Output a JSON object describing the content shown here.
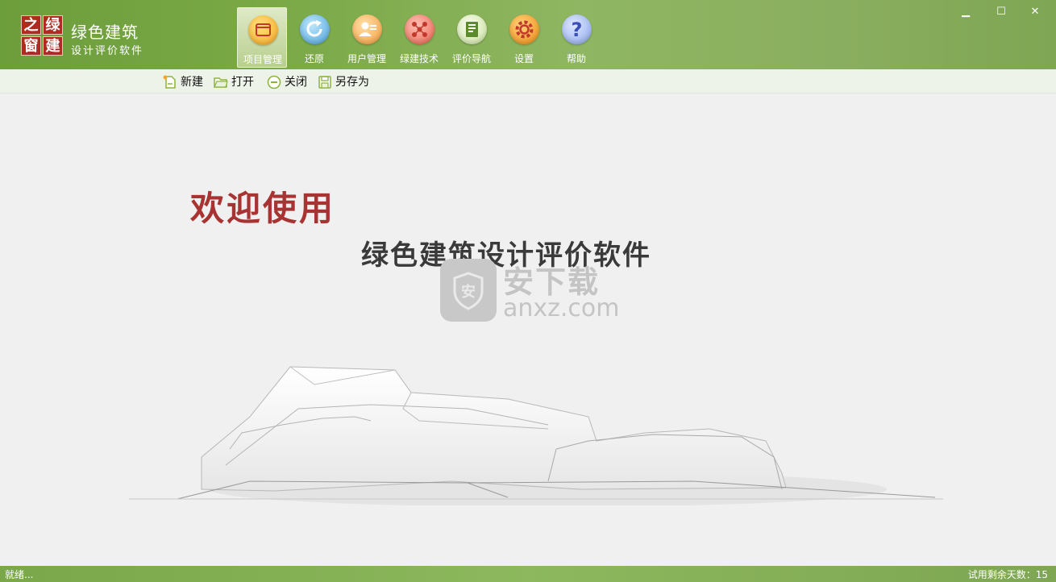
{
  "app": {
    "logo_chars": [
      "之",
      "绿",
      "窗",
      "建"
    ],
    "title": "绿色建筑",
    "subtitle": "设计评价软件"
  },
  "nav": [
    {
      "label": "项目管理",
      "icon": "project-icon",
      "color": "#f7b733",
      "active": true
    },
    {
      "label": "还原",
      "icon": "restore-icon",
      "color": "#5eb3e4",
      "active": false
    },
    {
      "label": "用户管理",
      "icon": "user-icon",
      "color": "#f5a84a",
      "active": false
    },
    {
      "label": "绿建技术",
      "icon": "tech-icon",
      "color": "#ef6f5f",
      "active": false
    },
    {
      "label": "评价导航",
      "icon": "book-icon",
      "color": "#cfe6a8",
      "active": false
    },
    {
      "label": "设置",
      "icon": "gear-icon",
      "color": "#f59a1e",
      "active": false
    },
    {
      "label": "帮助",
      "icon": "help-icon",
      "color": "#8fa9e8",
      "active": false
    }
  ],
  "window": {
    "minimize": "▁",
    "maximize": "☐",
    "close": "✕"
  },
  "toolbar": {
    "new": "新建",
    "open": "打开",
    "close": "关闭",
    "save_as": "另存为"
  },
  "main": {
    "welcome": "欢迎使用",
    "product": "绿色建筑设计评价软件"
  },
  "watermark": {
    "shield_char": "安",
    "cn": "安下载",
    "en": "anxz.com"
  },
  "status": {
    "left": "就绪...",
    "right": "试用剩余天数：15"
  },
  "colors": {
    "brand_green": "#79a845",
    "welcome_red": "#a73332",
    "toolbar_icon": "#8cb43a"
  }
}
